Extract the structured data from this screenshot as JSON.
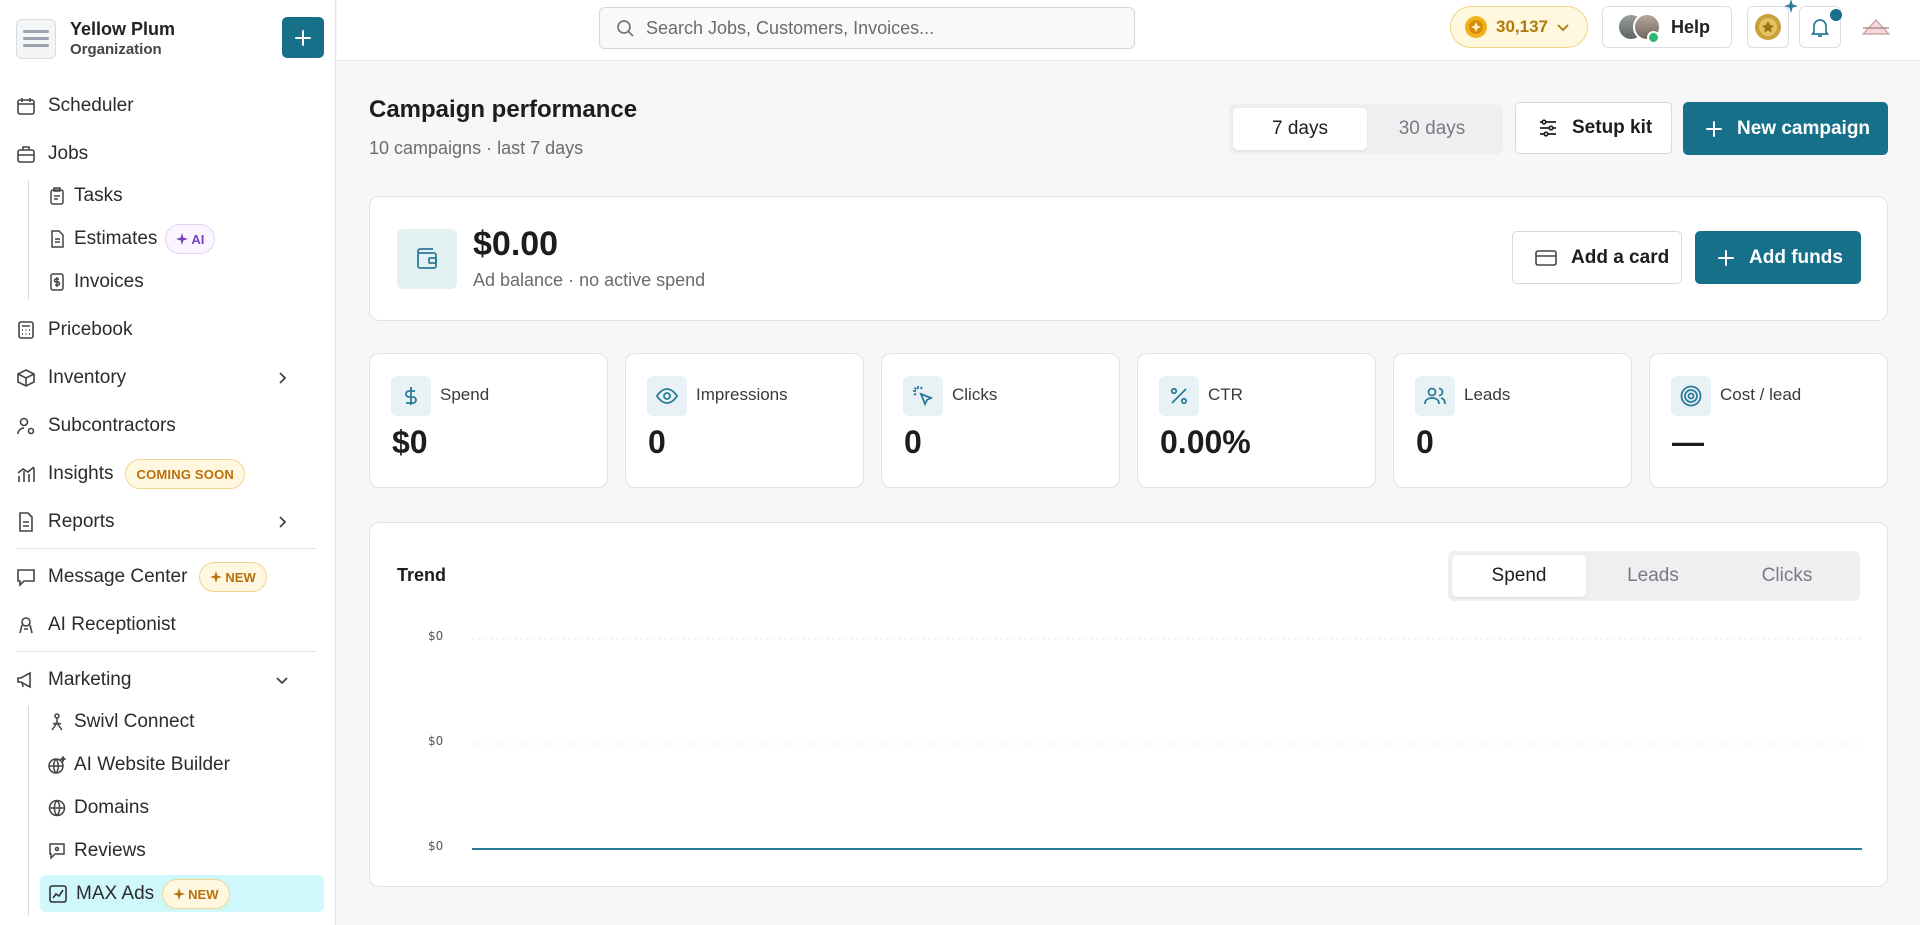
{
  "org": {
    "name": "Yellow Plum",
    "sub": "Organization"
  },
  "sidebar": {
    "scheduler": "Scheduler",
    "jobs": "Jobs",
    "tasks": "Tasks",
    "estimates": "Estimates",
    "estimates_badge": "AI",
    "invoices": "Invoices",
    "pricebook": "Pricebook",
    "inventory": "Inventory",
    "subcontractors": "Subcontractors",
    "insights": "Insights",
    "insights_badge": "COMING SOON",
    "reports": "Reports",
    "message_center": "Message Center",
    "message_badge": "NEW",
    "ai_receptionist": "AI Receptionist",
    "marketing": "Marketing",
    "swivl_connect": "Swivl Connect",
    "ai_website_builder": "AI Website Builder",
    "domains": "Domains",
    "reviews": "Reviews",
    "max_ads": "MAX Ads",
    "max_ads_badge": "NEW"
  },
  "topbar": {
    "search_placeholder": "Search Jobs, Customers, Invoices...",
    "coins": "30,137",
    "help": "Help"
  },
  "header": {
    "title": "Campaign performance",
    "subtitle": "10 campaigns · last 7 days",
    "range_7": "7 days",
    "range_30": "30 days",
    "setup_kit": "Setup kit",
    "new_campaign": "New campaign"
  },
  "balance": {
    "amount": "$0.00",
    "sub": "Ad balance · no active spend",
    "add_card": "Add a card",
    "add_funds": "Add funds"
  },
  "stats": [
    {
      "label": "Spend",
      "value": "$0",
      "icon": "dollar-icon"
    },
    {
      "label": "Impressions",
      "value": "0",
      "icon": "eye-icon"
    },
    {
      "label": "Clicks",
      "value": "0",
      "icon": "cursor-click-icon"
    },
    {
      "label": "CTR",
      "value": "0.00%",
      "icon": "percent-icon"
    },
    {
      "label": "Leads",
      "value": "0",
      "icon": "users-icon"
    },
    {
      "label": "Cost / lead",
      "value": "—",
      "icon": "target-icon"
    }
  ],
  "trend": {
    "title": "Trend",
    "tab_spend": "Spend",
    "tab_leads": "Leads",
    "tab_clicks": "Clicks",
    "accent": "#2b7a99"
  },
  "chart_data": {
    "type": "line",
    "title": "Trend",
    "xlabel": "",
    "ylabel": "",
    "yticks": [
      "$0",
      "$0",
      "$0"
    ],
    "series": [
      {
        "values": [
          0,
          0,
          0,
          0,
          0,
          0,
          0
        ]
      }
    ],
    "ylim": [
      0,
      0
    ],
    "grid": true
  },
  "colors": {
    "primary": "#17708a",
    "active_nav": "#cff8fc"
  }
}
